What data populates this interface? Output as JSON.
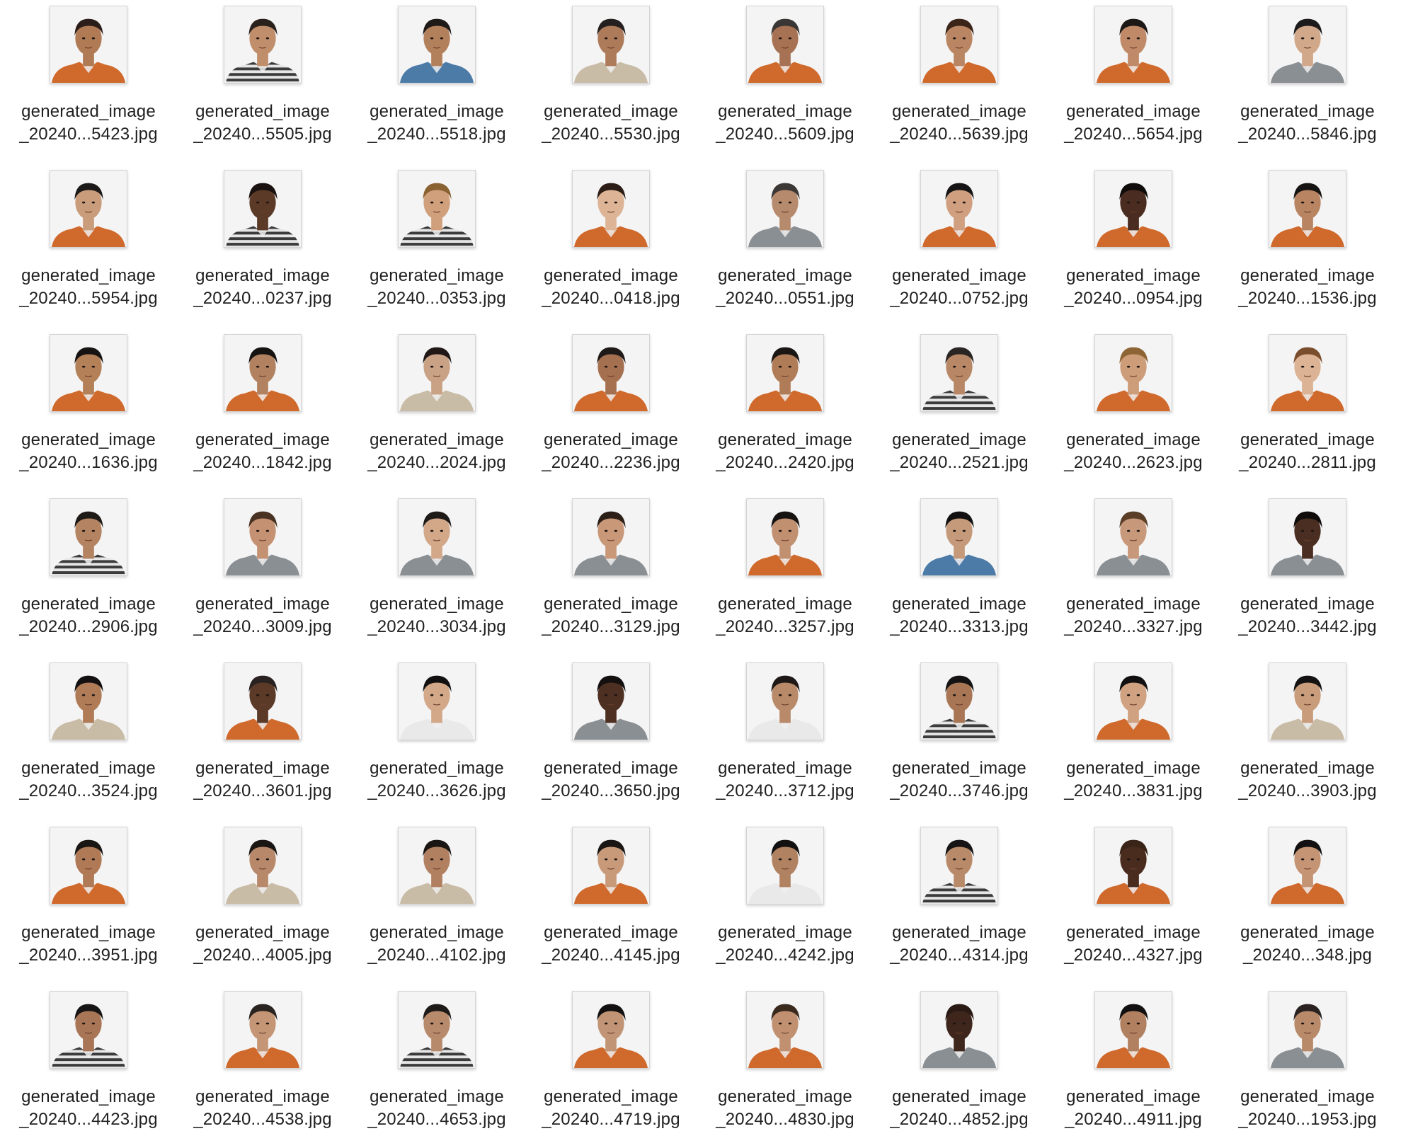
{
  "colors": {
    "orange": "#d0692c",
    "blue": "#4d7ba8",
    "grey": "#8a8f94",
    "khaki": "#c9bca7",
    "stripe": "#3b3b3b",
    "white": "#e9e9e9"
  },
  "files": [
    {
      "line1": "generated_image",
      "line2": "_20240...5423.jpg",
      "icon": "portrait-icon",
      "shirt": "orange",
      "skin": "#b07a55",
      "hair": "#2b1e1a"
    },
    {
      "line1": "generated_image",
      "line2": "_20240...5505.jpg",
      "icon": "portrait-icon",
      "shirt": "stripe",
      "skin": "#c18e6c",
      "hair": "#2a211c"
    },
    {
      "line1": "generated_image",
      "line2": "_20240...5518.jpg",
      "icon": "portrait-icon",
      "shirt": "blue",
      "skin": "#b3805c",
      "hair": "#1e1a18"
    },
    {
      "line1": "generated_image",
      "line2": "_20240...5530.jpg",
      "icon": "portrait-icon",
      "shirt": "khaki",
      "skin": "#ad7a5a",
      "hair": "#242020"
    },
    {
      "line1": "generated_image",
      "line2": "_20240...5609.jpg",
      "icon": "portrait-icon",
      "shirt": "orange",
      "skin": "#a67253",
      "hair": "#3a3635"
    },
    {
      "line1": "generated_image",
      "line2": "_20240...5639.jpg",
      "icon": "portrait-icon",
      "shirt": "orange",
      "skin": "#b98562",
      "hair": "#3a2518"
    },
    {
      "line1": "generated_image",
      "line2": "_20240...5654.jpg",
      "icon": "portrait-icon",
      "shirt": "orange",
      "skin": "#c08a68",
      "hair": "#1c1816"
    },
    {
      "line1": "generated_image",
      "line2": "_20240...5846.jpg",
      "icon": "portrait-icon",
      "shirt": "grey",
      "skin": "#d2a88a",
      "hair": "#1c1a1a"
    },
    {
      "line1": "generated_image",
      "line2": "_20240...5954.jpg",
      "icon": "portrait-icon",
      "shirt": "orange",
      "skin": "#c99c7c",
      "hair": "#1c1a19"
    },
    {
      "line1": "generated_image",
      "line2": "_20240...0237.jpg",
      "icon": "portrait-icon",
      "shirt": "stripe",
      "skin": "#5b3a28",
      "hair": "#1a1210"
    },
    {
      "line1": "generated_image",
      "line2": "_20240...0353.jpg",
      "icon": "portrait-icon",
      "shirt": "stripe",
      "skin": "#d0a07c",
      "hair": "#8a6232"
    },
    {
      "line1": "generated_image",
      "line2": "_20240...0418.jpg",
      "icon": "portrait-icon",
      "shirt": "orange",
      "skin": "#ddb596",
      "hair": "#2c1d16"
    },
    {
      "line1": "generated_image",
      "line2": "_20240...0551.jpg",
      "icon": "portrait-icon",
      "shirt": "grey",
      "skin": "#b68a6c",
      "hair": "#3c3836"
    },
    {
      "line1": "generated_image",
      "line2": "_20240...0752.jpg",
      "icon": "portrait-icon",
      "shirt": "orange",
      "skin": "#cf9f7f",
      "hair": "#161414"
    },
    {
      "line1": "generated_image",
      "line2": "_20240...0954.jpg",
      "icon": "portrait-icon",
      "shirt": "orange",
      "skin": "#4a2c20",
      "hair": "#0f0c0b"
    },
    {
      "line1": "generated_image",
      "line2": "_20240...1536.jpg",
      "icon": "portrait-icon",
      "shirt": "orange",
      "skin": "#b88461",
      "hair": "#161313"
    },
    {
      "line1": "generated_image",
      "line2": "_20240...1636.jpg",
      "icon": "portrait-icon",
      "shirt": "orange",
      "skin": "#b48058",
      "hair": "#161312"
    },
    {
      "line1": "generated_image",
      "line2": "_20240...1842.jpg",
      "icon": "portrait-icon",
      "shirt": "orange",
      "skin": "#b28260",
      "hair": "#161312"
    },
    {
      "line1": "generated_image",
      "line2": "_20240...2024.jpg",
      "icon": "portrait-icon",
      "shirt": "khaki",
      "skin": "#c9a184",
      "hair": "#1f1816"
    },
    {
      "line1": "generated_image",
      "line2": "_20240...2236.jpg",
      "icon": "portrait-icon",
      "shirt": "orange",
      "skin": "#a57050",
      "hair": "#1f1a18"
    },
    {
      "line1": "generated_image",
      "line2": "_20240...2420.jpg",
      "icon": "portrait-icon",
      "shirt": "orange",
      "skin": "#b07c58",
      "hair": "#1a1614"
    },
    {
      "line1": "generated_image",
      "line2": "_20240...2521.jpg",
      "icon": "portrait-icon",
      "shirt": "stripe",
      "skin": "#b88866",
      "hair": "#2a2422"
    },
    {
      "line1": "generated_image",
      "line2": "_20240...2623.jpg",
      "icon": "portrait-icon",
      "shirt": "orange",
      "skin": "#cd9c78",
      "hair": "#8d6434"
    },
    {
      "line1": "generated_image",
      "line2": "_20240...2811.jpg",
      "icon": "portrait-icon",
      "shirt": "orange",
      "skin": "#dcb394",
      "hair": "#7a4d2c"
    },
    {
      "line1": "generated_image",
      "line2": "_20240...2906.jpg",
      "icon": "portrait-icon",
      "shirt": "stripe",
      "skin": "#b48462",
      "hair": "#1e1a18"
    },
    {
      "line1": "generated_image",
      "line2": "_20240...3009.jpg",
      "icon": "portrait-icon",
      "shirt": "grey",
      "skin": "#c49272",
      "hair": "#4a3222"
    },
    {
      "line1": "generated_image",
      "line2": "_20240...3034.jpg",
      "icon": "portrait-icon",
      "shirt": "grey",
      "skin": "#d2a888",
      "hair": "#1e1a18"
    },
    {
      "line1": "generated_image",
      "line2": "_20240...3129.jpg",
      "icon": "portrait-icon",
      "shirt": "grey",
      "skin": "#c89878",
      "hair": "#2c1f18"
    },
    {
      "line1": "generated_image",
      "line2": "_20240...3257.jpg",
      "icon": "portrait-icon",
      "shirt": "orange",
      "skin": "#c09070",
      "hair": "#161312"
    },
    {
      "line1": "generated_image",
      "line2": "_20240...3313.jpg",
      "icon": "portrait-icon",
      "shirt": "blue",
      "skin": "#c49a7a",
      "hair": "#121010"
    },
    {
      "line1": "generated_image",
      "line2": "_20240...3327.jpg",
      "icon": "portrait-icon",
      "shirt": "grey",
      "skin": "#c8987a",
      "hair": "#5a3e28"
    },
    {
      "line1": "generated_image",
      "line2": "_20240...3442.jpg",
      "icon": "portrait-icon",
      "shirt": "grey",
      "skin": "#4a2e22",
      "hair": "#0f0c0b"
    },
    {
      "line1": "generated_image",
      "line2": "_20240...3524.jpg",
      "icon": "portrait-icon",
      "shirt": "khaki",
      "skin": "#b07c58",
      "hair": "#121010"
    },
    {
      "line1": "generated_image",
      "line2": "_20240...3601.jpg",
      "icon": "portrait-icon",
      "shirt": "orange",
      "skin": "#5c3a28",
      "hair": "#2a2220"
    },
    {
      "line1": "generated_image",
      "line2": "_20240...3626.jpg",
      "icon": "portrait-icon",
      "shirt": "white",
      "skin": "#d2a888",
      "hair": "#121010"
    },
    {
      "line1": "generated_image",
      "line2": "_20240...3650.jpg",
      "icon": "portrait-icon",
      "shirt": "grey",
      "skin": "#4e3022",
      "hair": "#141010"
    },
    {
      "line1": "generated_image",
      "line2": "_20240...3712.jpg",
      "icon": "portrait-icon",
      "shirt": "white",
      "skin": "#b88a6a",
      "hair": "#1e1816"
    },
    {
      "line1": "generated_image",
      "line2": "_20240...3746.jpg",
      "icon": "portrait-icon",
      "shirt": "stripe",
      "skin": "#a87654",
      "hair": "#141212"
    },
    {
      "line1": "generated_image",
      "line2": "_20240...3831.jpg",
      "icon": "portrait-icon",
      "shirt": "orange",
      "skin": "#d0a282",
      "hair": "#121010"
    },
    {
      "line1": "generated_image",
      "line2": "_20240...3903.jpg",
      "icon": "portrait-icon",
      "shirt": "khaki",
      "skin": "#c99c7c",
      "hair": "#141212"
    },
    {
      "line1": "generated_image",
      "line2": "_20240...3951.jpg",
      "icon": "portrait-icon",
      "shirt": "orange",
      "skin": "#b07a56",
      "hair": "#1a1614"
    },
    {
      "line1": "generated_image",
      "line2": "_20240...4005.jpg",
      "icon": "portrait-icon",
      "shirt": "khaki",
      "skin": "#b8886a",
      "hair": "#1a1614"
    },
    {
      "line1": "generated_image",
      "line2": "_20240...4102.jpg",
      "icon": "portrait-icon",
      "shirt": "khaki",
      "skin": "#b08060",
      "hair": "#1a1614"
    },
    {
      "line1": "generated_image",
      "line2": "_20240...4145.jpg",
      "icon": "portrait-icon",
      "shirt": "orange",
      "skin": "#c89a7a",
      "hair": "#1a1614"
    },
    {
      "line1": "generated_image",
      "line2": "_20240...4242.jpg",
      "icon": "portrait-icon",
      "shirt": "white",
      "skin": "#b08262",
      "hair": "#121010"
    },
    {
      "line1": "generated_image",
      "line2": "_20240...4314.jpg",
      "icon": "portrait-icon",
      "shirt": "stripe",
      "skin": "#b88a6a",
      "hair": "#161414"
    },
    {
      "line1": "generated_image",
      "line2": "_20240...4327.jpg",
      "icon": "portrait-icon",
      "shirt": "orange",
      "skin": "#4a2c1e",
      "hair": "#3a2418"
    },
    {
      "line1": "generated_image",
      "line2": "_20240...348.jpg",
      "icon": "portrait-icon",
      "shirt": "orange",
      "skin": "#c49474",
      "hair": "#121010"
    },
    {
      "line1": "generated_image",
      "line2": "_20240...4423.jpg",
      "icon": "portrait-icon",
      "shirt": "stripe",
      "skin": "#a87656",
      "hair": "#161414"
    },
    {
      "line1": "generated_image",
      "line2": "_20240...4538.jpg",
      "icon": "portrait-icon",
      "shirt": "orange",
      "skin": "#c49676",
      "hair": "#2a2420"
    },
    {
      "line1": "generated_image",
      "line2": "_20240...4653.jpg",
      "icon": "portrait-icon",
      "shirt": "stripe",
      "skin": "#b88a6c",
      "hair": "#1e1a18"
    },
    {
      "line1": "generated_image",
      "line2": "_20240...4719.jpg",
      "icon": "portrait-icon",
      "shirt": "orange",
      "skin": "#c09474",
      "hair": "#121010"
    },
    {
      "line1": "generated_image",
      "line2": "_20240...4830.jpg",
      "icon": "portrait-icon",
      "shirt": "orange",
      "skin": "#c09070",
      "hair": "#3a2a1e"
    },
    {
      "line1": "generated_image",
      "line2": "_20240...4852.jpg",
      "icon": "portrait-icon",
      "shirt": "grey",
      "skin": "#3e261c",
      "hair": "#2a1a14"
    },
    {
      "line1": "generated_image",
      "line2": "_20240...4911.jpg",
      "icon": "portrait-icon",
      "shirt": "orange",
      "skin": "#b08060",
      "hair": "#121010"
    },
    {
      "line1": "generated_image",
      "line2": "_20240...1953.jpg",
      "icon": "portrait-icon",
      "shirt": "grey",
      "skin": "#b88a6a",
      "hair": "#2a2220"
    }
  ]
}
